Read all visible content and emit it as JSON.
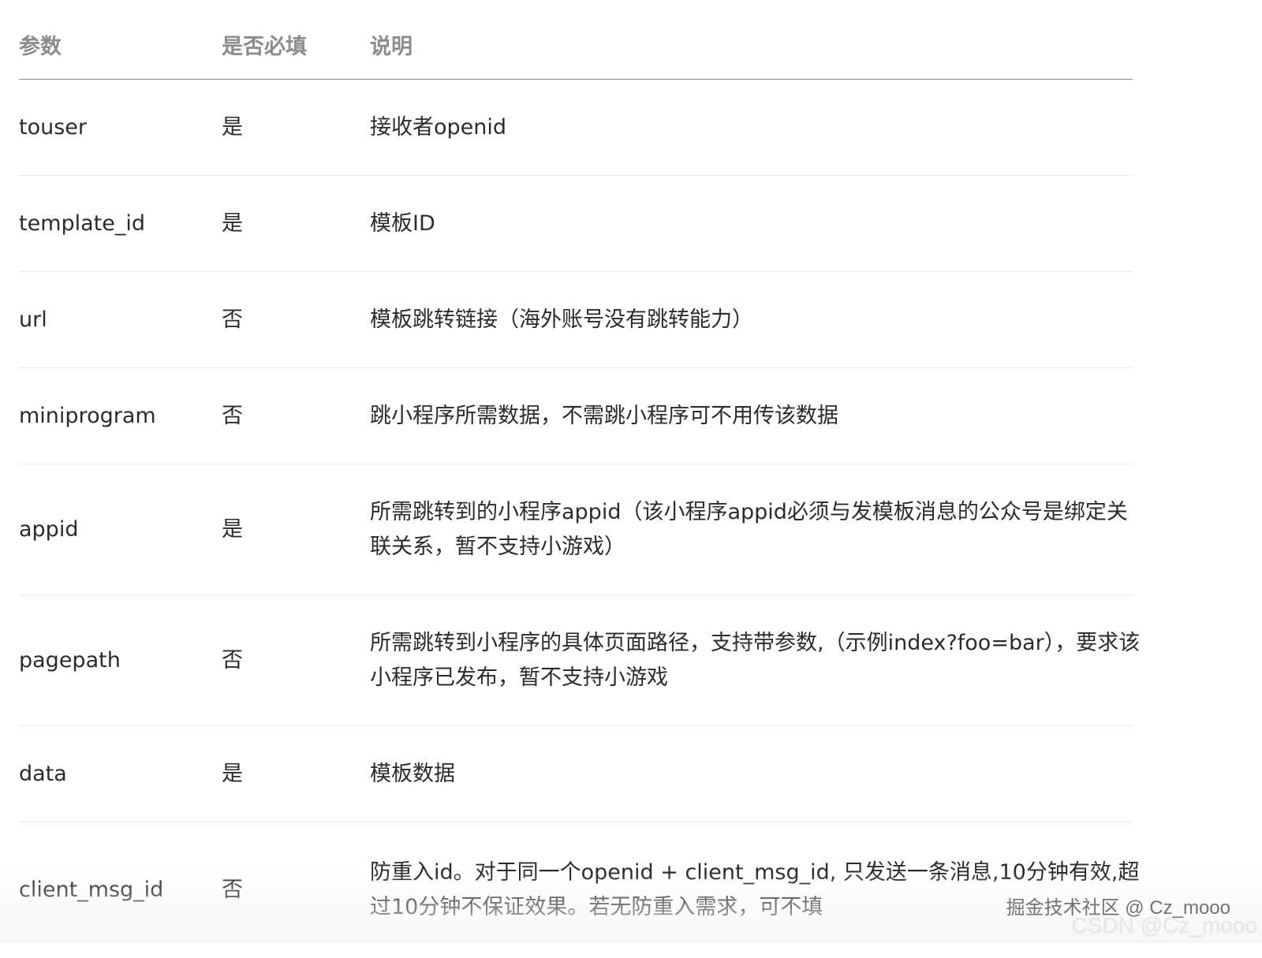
{
  "header": {
    "param": "参数",
    "required": "是否必填",
    "description": "说明"
  },
  "rows": [
    {
      "param": "touser",
      "required": "是",
      "description": "接收者openid"
    },
    {
      "param": "template_id",
      "required": "是",
      "description": "模板ID"
    },
    {
      "param": "url",
      "required": "否",
      "description": "模板跳转链接（海外账号没有跳转能力）"
    },
    {
      "param": "miniprogram",
      "required": "否",
      "description": "跳小程序所需数据，不需跳小程序可不用传该数据"
    },
    {
      "param": "appid",
      "required": "是",
      "description": "所需跳转到的小程序appid（该小程序appid必须与发模板消息的公众号是绑定关联关系，暂不支持小游戏）"
    },
    {
      "param": "pagepath",
      "required": "否",
      "description": "所需跳转到小程序的具体页面路径，支持带参数,（示例index?foo=bar），要求该小程序已发布，暂不支持小游戏"
    },
    {
      "param": "data",
      "required": "是",
      "description": "模板数据"
    },
    {
      "param": "client_msg_id",
      "required": "否",
      "description": "防重入id。对于同一个openid + client_msg_id, 只发送一条消息,10分钟有效,超过10分钟不保证效果。若无防重入需求，可不填"
    }
  ],
  "watermarks": {
    "juejin": "掘金技术社区 @ Cz_mooo",
    "csdn": "CSDN @Cz_mooo"
  }
}
